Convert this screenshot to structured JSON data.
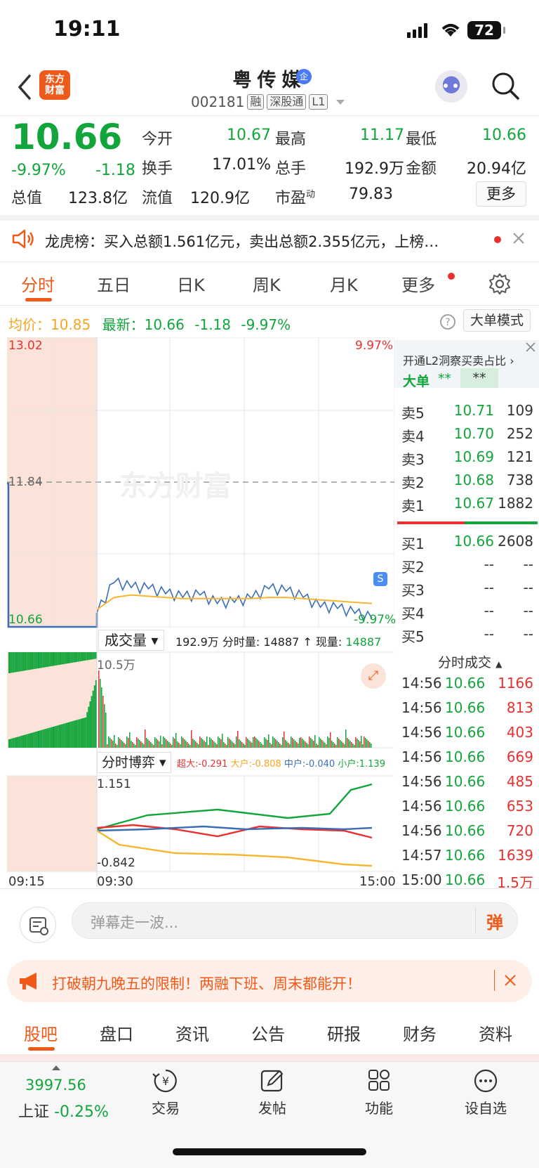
{
  "status": {
    "time": "19:11",
    "battery": "72"
  },
  "header": {
    "logo_line1": "东方",
    "logo_line2": "财富",
    "stock_name": "粤传媒",
    "badge": "企",
    "code": "002181",
    "tag_rong": "融",
    "tag_sgt": "深股通",
    "tag_l1": "L1"
  },
  "quote": {
    "price": "10.66",
    "pct": "-9.97%",
    "change": "-1.18",
    "stats": [
      {
        "label": "今开",
        "value": "10.67",
        "color": "green"
      },
      {
        "label": "最高",
        "value": "11.17",
        "color": "green"
      },
      {
        "label": "最低",
        "value": "10.66",
        "color": "green"
      },
      {
        "label": "换手",
        "value": "17.01%",
        "color": "black"
      },
      {
        "label": "总手",
        "value": "192.9万",
        "color": "black"
      },
      {
        "label": "金额",
        "value": "20.94亿",
        "color": "black"
      },
      {
        "label": "总值",
        "value": "123.8亿",
        "color": "black"
      },
      {
        "label": "流值",
        "value": "120.9亿",
        "color": "black"
      },
      {
        "label": "市盈",
        "value": "79.83",
        "color": "black",
        "sup": "动"
      }
    ],
    "more_label": "更多"
  },
  "notice": {
    "text": "龙虎榜：买入总额1.561亿元，卖出总额2.355亿元，上榜…"
  },
  "tabs": [
    "分时",
    "五日",
    "日K",
    "周K",
    "月K",
    "更多"
  ],
  "avg_row": {
    "avg_label": "均价：",
    "avg_value": "10.85",
    "latest_label": "最新：",
    "latest_value": "10.66",
    "latest_change": "-1.18",
    "latest_pct": "-9.97%"
  },
  "big_order_mode": "大单模式",
  "chart": {
    "price_top": "13.02",
    "price_mid": "11.84",
    "price_bottom": "10.66",
    "pct_top": "9.97%",
    "pct_bottom": "-9.97%",
    "watermark": "东方财富",
    "volume_selector": "成交量",
    "volume_info_total": "192.9万",
    "volume_info_label": "分时量:",
    "volume_info_value": "14887",
    "volume_now_label": "现量:",
    "volume_now_value": "14887",
    "volume_max": "10.5万",
    "game_selector": "分时博弈",
    "game_legend": [
      {
        "label": "超大:",
        "value": "-0.291",
        "color": "#e8312f"
      },
      {
        "label": "大户:",
        "value": "-0.808",
        "color": "#f5a623"
      },
      {
        "label": "中户:",
        "value": "-0.040",
        "color": "#3b6db5"
      },
      {
        "label": "小户:",
        "value": "1.139",
        "color": "#12a53c"
      }
    ],
    "game_top": "1.151",
    "game_bottom": "-0.842",
    "time_start": "09:15",
    "time_open": "09:30",
    "time_end": "15:00"
  },
  "chart_data": {
    "type": "line",
    "title": "",
    "xlabel": "",
    "ylabel": "",
    "x_range": [
      "09:30",
      "15:00"
    ],
    "ylim": [
      10.66,
      13.02
    ],
    "series": [
      {
        "values": [
          10.77,
          11.02,
          10.98,
          10.97,
          10.93,
          10.9,
          10.92,
          10.85,
          10.86,
          10.89,
          10.97,
          10.95,
          10.9,
          10.82,
          10.81,
          10.77,
          10.73
        ]
      },
      {
        "values": [
          10.8,
          10.9,
          10.92,
          10.91,
          10.9,
          10.89,
          10.89,
          10.89,
          10.89,
          10.89,
          10.9,
          10.9,
          10.89,
          10.88,
          10.87,
          10.86,
          10.85
        ]
      }
    ]
  },
  "orderbook": {
    "promo": "开通L2洞察买卖占比",
    "big_label": "大单",
    "big_val1": "**",
    "big_val2": "**",
    "asks": [
      {
        "label": "卖5",
        "price": "10.71",
        "vol": "109"
      },
      {
        "label": "卖4",
        "price": "10.70",
        "vol": "252"
      },
      {
        "label": "卖3",
        "price": "10.69",
        "vol": "121"
      },
      {
        "label": "卖2",
        "price": "10.68",
        "vol": "738"
      },
      {
        "label": "卖1",
        "price": "10.67",
        "vol": "1882"
      }
    ],
    "bids": [
      {
        "label": "买1",
        "price": "10.66",
        "vol": "2608"
      },
      {
        "label": "买2",
        "price": "--",
        "vol": "--"
      },
      {
        "label": "买3",
        "price": "--",
        "vol": "--"
      },
      {
        "label": "买4",
        "price": "--",
        "vol": "--"
      },
      {
        "label": "买5",
        "price": "--",
        "vol": "--"
      }
    ],
    "ticks_title": "分时成交",
    "ticks": [
      {
        "time": "14:56",
        "price": "10.66",
        "vol": "1166"
      },
      {
        "time": "14:56",
        "price": "10.66",
        "vol": "813"
      },
      {
        "time": "14:56",
        "price": "10.66",
        "vol": "403"
      },
      {
        "time": "14:56",
        "price": "10.66",
        "vol": "669"
      },
      {
        "time": "14:56",
        "price": "10.66",
        "vol": "485"
      },
      {
        "time": "14:56",
        "price": "10.66",
        "vol": "653"
      },
      {
        "time": "14:56",
        "price": "10.66",
        "vol": "720"
      },
      {
        "time": "14:57",
        "price": "10.66",
        "vol": "1639"
      },
      {
        "time": "15:00",
        "price": "10.66",
        "vol": "1.5万"
      }
    ]
  },
  "comment": {
    "placeholder": "弹幕走一波...",
    "danmu_label": "弹"
  },
  "ad": {
    "text": "打破朝九晚五的限制！两融下班、周末都能开！"
  },
  "bottom_tabs": [
    "股吧",
    "盘口",
    "资讯",
    "公告",
    "研报",
    "财务",
    "资料"
  ],
  "dock": {
    "index_value": "3997.56",
    "index_name": "上证",
    "index_pct": "-0.25%",
    "items": [
      "交易",
      "发帖",
      "功能",
      "设自选"
    ]
  },
  "colors": {
    "accent": "#ef5a1b",
    "down": "#12a53c",
    "up": "#e8312f"
  }
}
